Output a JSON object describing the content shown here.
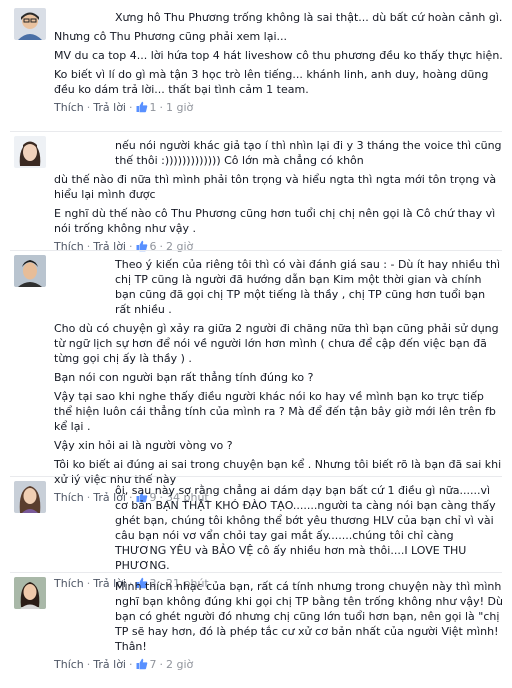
{
  "comments": [
    {
      "paragraphs": [
        "Xưng hô Thu Phương trống không là sai thật... dù bất cứ hoàn cảnh gì.",
        "Nhưng cô Thu Phương cũng phải xem lại...",
        "MV du ca top 4... lời hứa top 4 hát liveshow cô thu phương đều ko thấy thực hiện.",
        "Ko biết vì lí do gì mà tận 3 học trò lên tiếng... khánh linh, anh duy, hoàng dũng đều ko dám trả lời... thất bại tình cảm 1 team."
      ],
      "like_label": "Thích",
      "reply_label": "Trả lời",
      "likes": "1",
      "time": "1 giờ"
    },
    {
      "paragraphs": [
        "nếu nói người khác giả tạo í thì nhìn lại đi y 3 tháng the voice thì cũng thế thôi :))))))))))))) Cô lớn mà chẳng có khôn",
        "dù thế nào đi nữa thì mình phải tôn trọng và hiểu ngta thì ngta mới tôn trọng và hiểu lại mình được",
        "E nghĩ dù thế nào cô Thu Phương cũng hơn tuổi chị chị nên gọi là Cô chứ thay vì nói trống không như vậy ."
      ],
      "like_label": "Thích",
      "reply_label": "Trả lời",
      "likes": "6",
      "time": "2 giờ"
    },
    {
      "paragraphs": [
        "Theo ý kiến của riêng tôi thì có vài đánh giá sau : - Dù ít hay nhiều thì chị TP cũng là người đã hướng dẫn bạn Kim một thời gian và chính bạn cũng đã gọi chị TP một tiếng là thầy , chị TP cũng hơn tuổi bạn rất nhiều .",
        "Cho dù có chuyện gì xảy ra giữa 2 người đi chăng nữa thì bạn cũng phải sử dụng từ ngữ lịch sự hơn để nói về người lớn hơn mình ( chưa để cập đến việc bạn đã từng gọi chị ấy là thầy ) .",
        "Bạn nói con người bạn rất thẳng tính đúng ko ?",
        "Vậy tại sao khi nghe thấy điều người khác nói ko hay về mình bạn ko trực tiếp thể hiện luôn cái thẳng tính của mình ra ? Mà để đến tận bây giờ mới lên trên fb kể lại .",
        "Vậy xin hỏi ai là người vòng vo ?",
        "Tôi ko biết ai đúng ai sai trong chuyện bạn kể . Nhưng tôi biết rõ là bạn đã sai khi xử lý việc như thế này"
      ],
      "like_label": "Thích",
      "reply_label": "Trả lời",
      "likes": "9",
      "time": "34 phút"
    },
    {
      "paragraphs": [
        "ôi, sau này sợ rằng chẳng ai dám dạy bạn bất cứ 1 điều gì nữa......vì cơ bản BẠN THẬT KHÓ ĐÀO TẠO.......người ta càng nói bạn càng thấy ghét bạn, chúng tôi không thể bớt yêu thương HLV của bạn chỉ vì vài câu bạn nói vơ vẩn chỏi tay gai mắt ấy.......chúng tôi chỉ càng THƯƠNG YÊU và BẢO VỆ cô ấy nhiều hơn mà thôi....I LOVE THU PHƯƠNG."
      ],
      "like_label": "Thích",
      "reply_label": "Trả lời",
      "likes": "3",
      "time": "21 phút"
    },
    {
      "paragraphs": [
        "Mình thích nhạc của bạn, rất cá tính nhưng trong chuyện này thì mình nghĩ bạn không đúng khi gọi chị TP bằng tên trống không như vậy! Dù bạn có ghét người đó nhưng chị cũng lớn tuổi hơn bạn, nên gọi là \"chị TP sẽ hay hơn, đó là phép tắc cư xử cơ bản nhất của người Việt mình! Thân!"
      ],
      "like_label": "Thích",
      "reply_label": "Trả lời",
      "likes": "7",
      "time": "2 giờ"
    }
  ],
  "colors": {
    "link": "#4e5665",
    "meta": "#90949c",
    "text": "#141823",
    "like_icon": "#5890ff"
  },
  "icons": {
    "like": "thumbs-up-icon"
  }
}
